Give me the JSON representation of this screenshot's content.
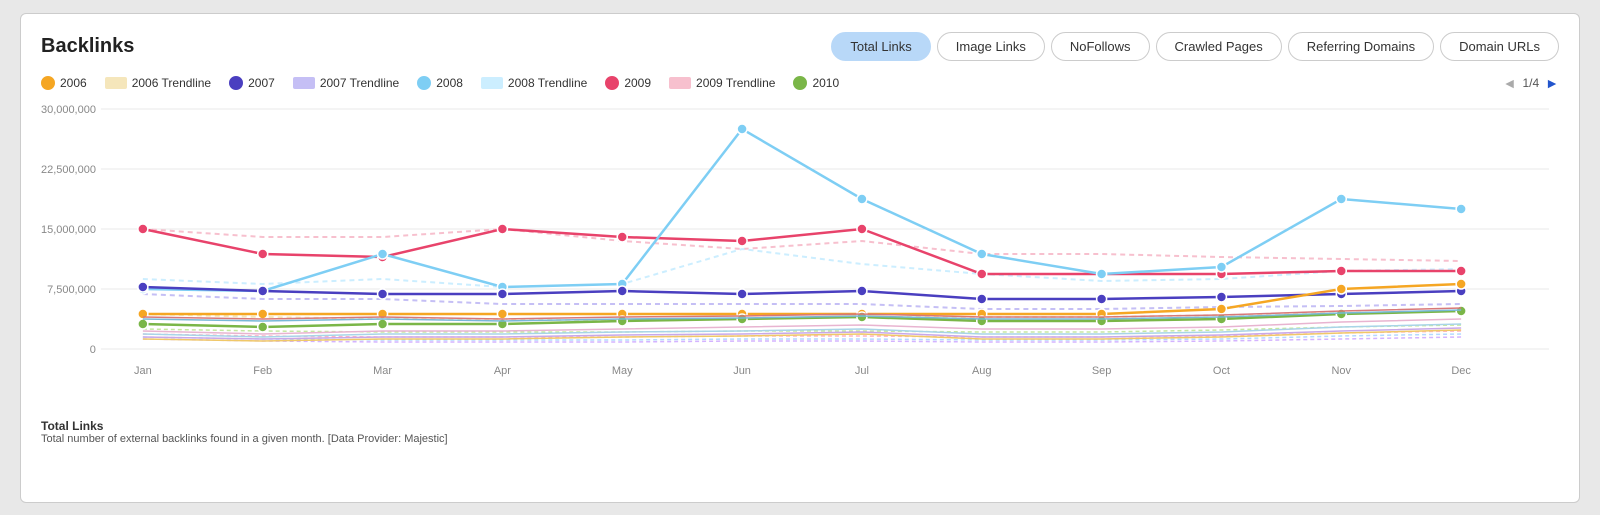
{
  "title": "Backlinks",
  "tabs": [
    {
      "label": "Total Links",
      "active": true
    },
    {
      "label": "Image Links",
      "active": false
    },
    {
      "label": "NoFollows",
      "active": false
    },
    {
      "label": "Crawled Pages",
      "active": false
    },
    {
      "label": "Referring Domains",
      "active": false
    },
    {
      "label": "Domain URLs",
      "active": false
    }
  ],
  "legend": [
    {
      "label": "2006",
      "type": "dot",
      "color": "#f5a623"
    },
    {
      "label": "2006 Trendline",
      "type": "rect",
      "color": "#f5e6bb"
    },
    {
      "label": "2007",
      "type": "dot",
      "color": "#4a3fc0"
    },
    {
      "label": "2007 Trendline",
      "type": "rect",
      "color": "#c5bff5"
    },
    {
      "label": "2008",
      "type": "dot",
      "color": "#7ecef4"
    },
    {
      "label": "2008 Trendline",
      "type": "rect",
      "color": "#cceeff"
    },
    {
      "label": "2009",
      "type": "dot",
      "color": "#e8436b"
    },
    {
      "label": "2009 Trendline",
      "type": "rect",
      "color": "#f7c0ce"
    },
    {
      "label": "2010",
      "type": "dot",
      "color": "#7ab648"
    }
  ],
  "pagination": "1/4",
  "y_axis_labels": [
    "30,000,000",
    "22,500,000",
    "15,000,000",
    "7,500,000",
    "0"
  ],
  "x_axis_labels": [
    "Jan",
    "Feb",
    "Mar",
    "Apr",
    "May",
    "Jun",
    "Jul",
    "Aug",
    "Sep",
    "Oct",
    "Nov",
    "Dec"
  ],
  "footer_title": "Total Links",
  "footer_desc": "Total number of external backlinks found in a given month. [Data Provider: Majestic]"
}
